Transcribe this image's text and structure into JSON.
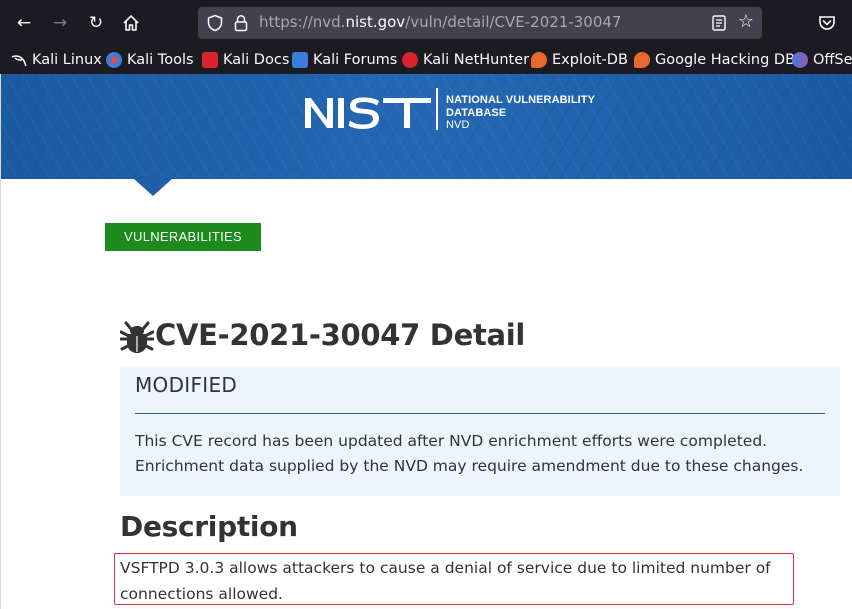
{
  "browser": {
    "url_prefix": "https://nvd.",
    "url_host": "nist.gov",
    "url_path": "/vuln/detail/CVE-2021-30047"
  },
  "bookmarks": [
    {
      "label": "Kali Linux",
      "icon": "kali-dragon-icon",
      "color": "#fbfbfe"
    },
    {
      "label": "Kali Tools",
      "icon": "kali-tools-icon",
      "color": "#e84a3c"
    },
    {
      "label": "Kali Docs",
      "icon": "kali-docs-icon",
      "color": "#d9232e"
    },
    {
      "label": "Kali Forums",
      "icon": "kali-forums-icon",
      "color": "#3b7dd8"
    },
    {
      "label": "Kali NetHunter",
      "icon": "nethunter-icon",
      "color": "#d9232e"
    },
    {
      "label": "Exploit-DB",
      "icon": "exploit-db-icon",
      "color": "#e8692a"
    },
    {
      "label": "Google Hacking DB",
      "icon": "ghdb-icon",
      "color": "#e8692a"
    },
    {
      "label": "OffSec",
      "icon": "offsec-icon",
      "color": "#6a5acd"
    }
  ],
  "header": {
    "logo_text": "NIST",
    "nvd_line1": "NATIONAL VULNERABILITY",
    "nvd_line2": "DATABASE",
    "nvd_line3": "NVD",
    "bg_color": "#1f5ea8"
  },
  "nav": {
    "vulnerabilities_label": "VULNERABILITIES",
    "chip_color": "#1d8a1d"
  },
  "page": {
    "title": "CVE-2021-30047 Detail"
  },
  "modified": {
    "label": "MODIFIED",
    "text": "This CVE record has been updated after NVD enrichment efforts were completed. Enrichment data supplied by the NVD may require amendment due to these changes."
  },
  "description": {
    "heading": "Description",
    "text": "VSFTPD 3.0.3 allows attackers to cause a denial of service due to limited number of connections allowed.",
    "highlight_color": "#e0303a"
  }
}
